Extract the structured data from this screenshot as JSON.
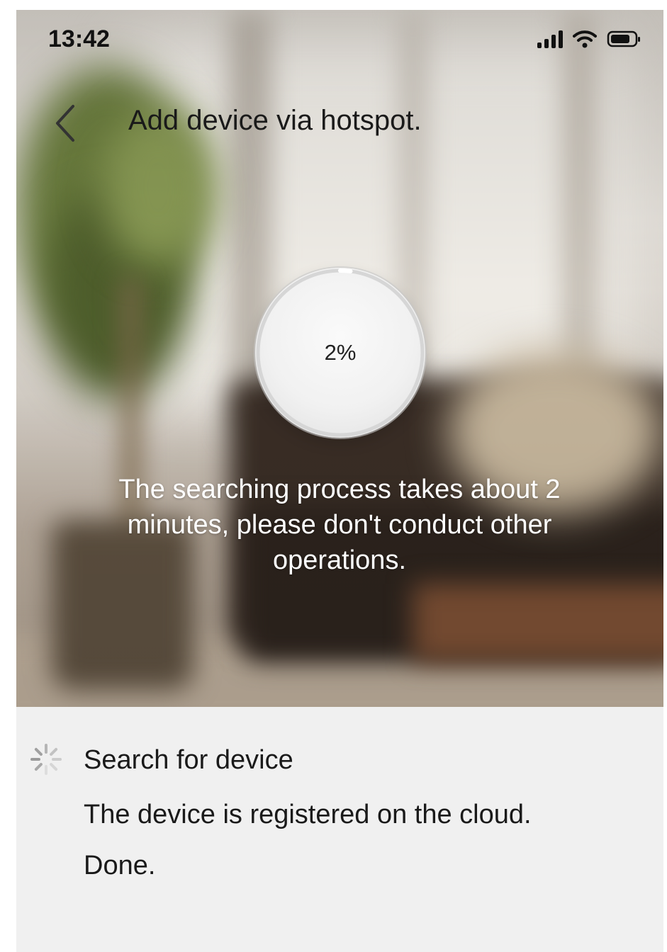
{
  "status_bar": {
    "time": "13:42",
    "icons": [
      "signal-icon",
      "wifi-icon",
      "battery-icon"
    ]
  },
  "header": {
    "back_icon": "chevron-left-icon",
    "title": "Add device via hotspot."
  },
  "progress": {
    "label": "2%",
    "value": 0.02
  },
  "notice": {
    "text": "The searching process takes about 2 minutes, please don't conduct other operations."
  },
  "steps": {
    "items": [
      {
        "icon": "spinner-icon",
        "title": "Search for device",
        "description": "The device is registered on the cloud. Done."
      }
    ]
  },
  "colors": {
    "text_dark": "#1a1a1a",
    "notice_text": "#ffffff",
    "panel_bg": "#f0f0f0"
  }
}
